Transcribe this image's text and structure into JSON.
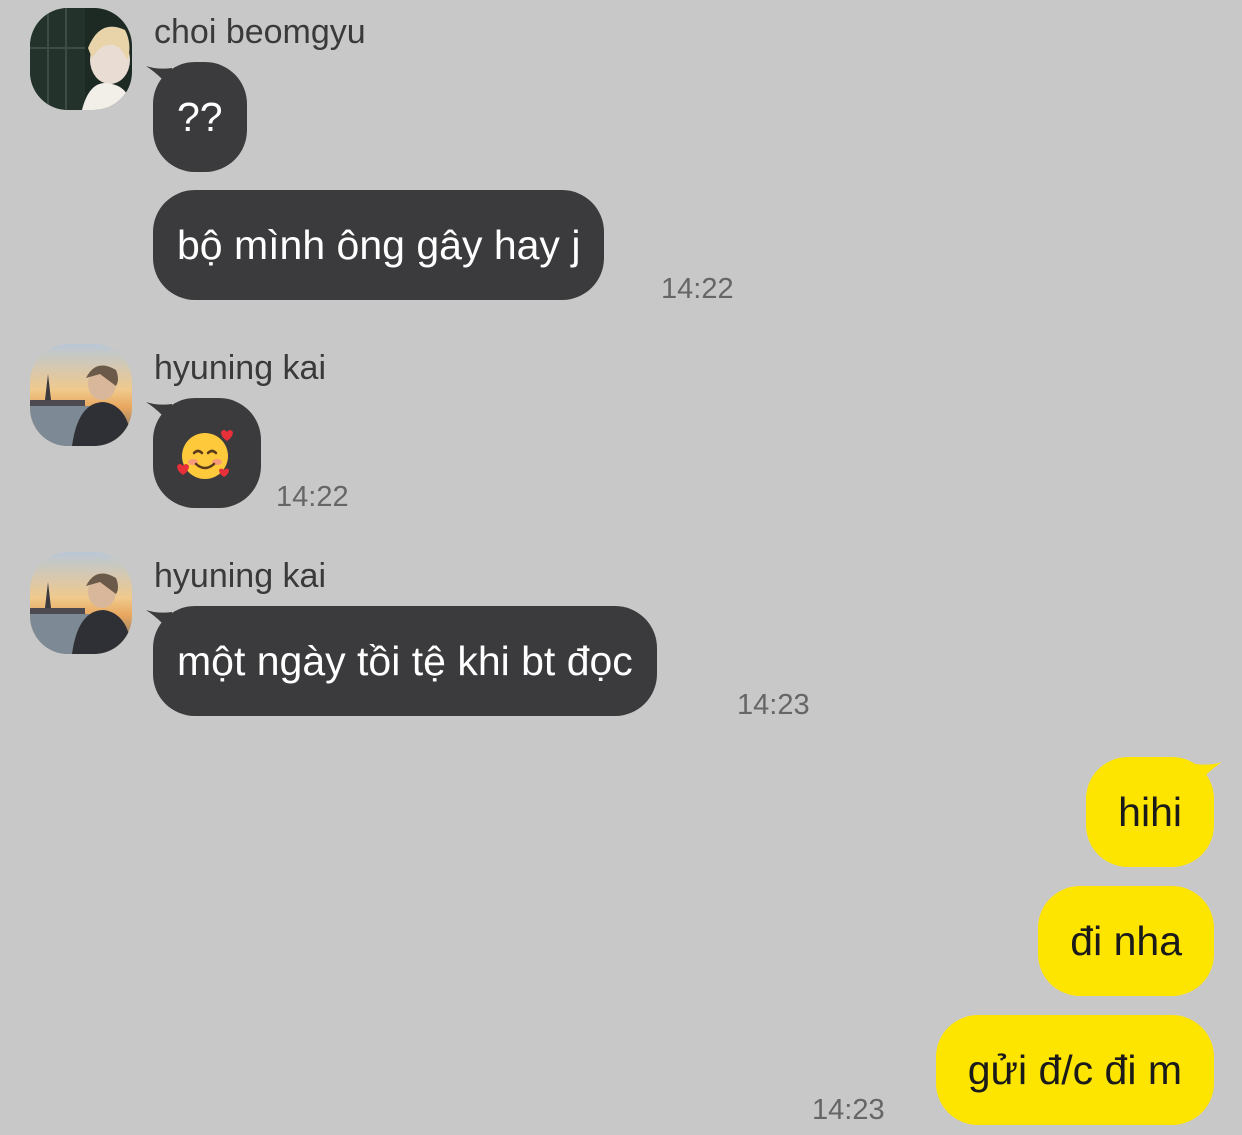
{
  "colors": {
    "background": "#c8c8c8",
    "incoming_bubble": "#3b3b3d",
    "outgoing_bubble": "#fee500",
    "timestamp": "#666666"
  },
  "groups": [
    {
      "sender": "choi beomgyu",
      "avatar": "avatar-beomgyu",
      "messages": [
        {
          "text": "??"
        },
        {
          "text": "bộ mình ông gây hay j",
          "time": "14:22"
        }
      ]
    },
    {
      "sender": "hyuning kai",
      "avatar": "avatar-kai",
      "messages": [
        {
          "emoji": "smiling-face-with-hearts-icon",
          "time": "14:22"
        }
      ]
    },
    {
      "sender": "hyuning kai",
      "avatar": "avatar-kai",
      "messages": [
        {
          "text": "một ngày tồi tệ khi bt đọc",
          "time": "14:23"
        }
      ]
    }
  ],
  "outgoing": {
    "messages": [
      {
        "text": "hihi"
      },
      {
        "text": "đi nha"
      },
      {
        "text": "gửi đ/c đi m"
      }
    ],
    "time": "14:23"
  }
}
